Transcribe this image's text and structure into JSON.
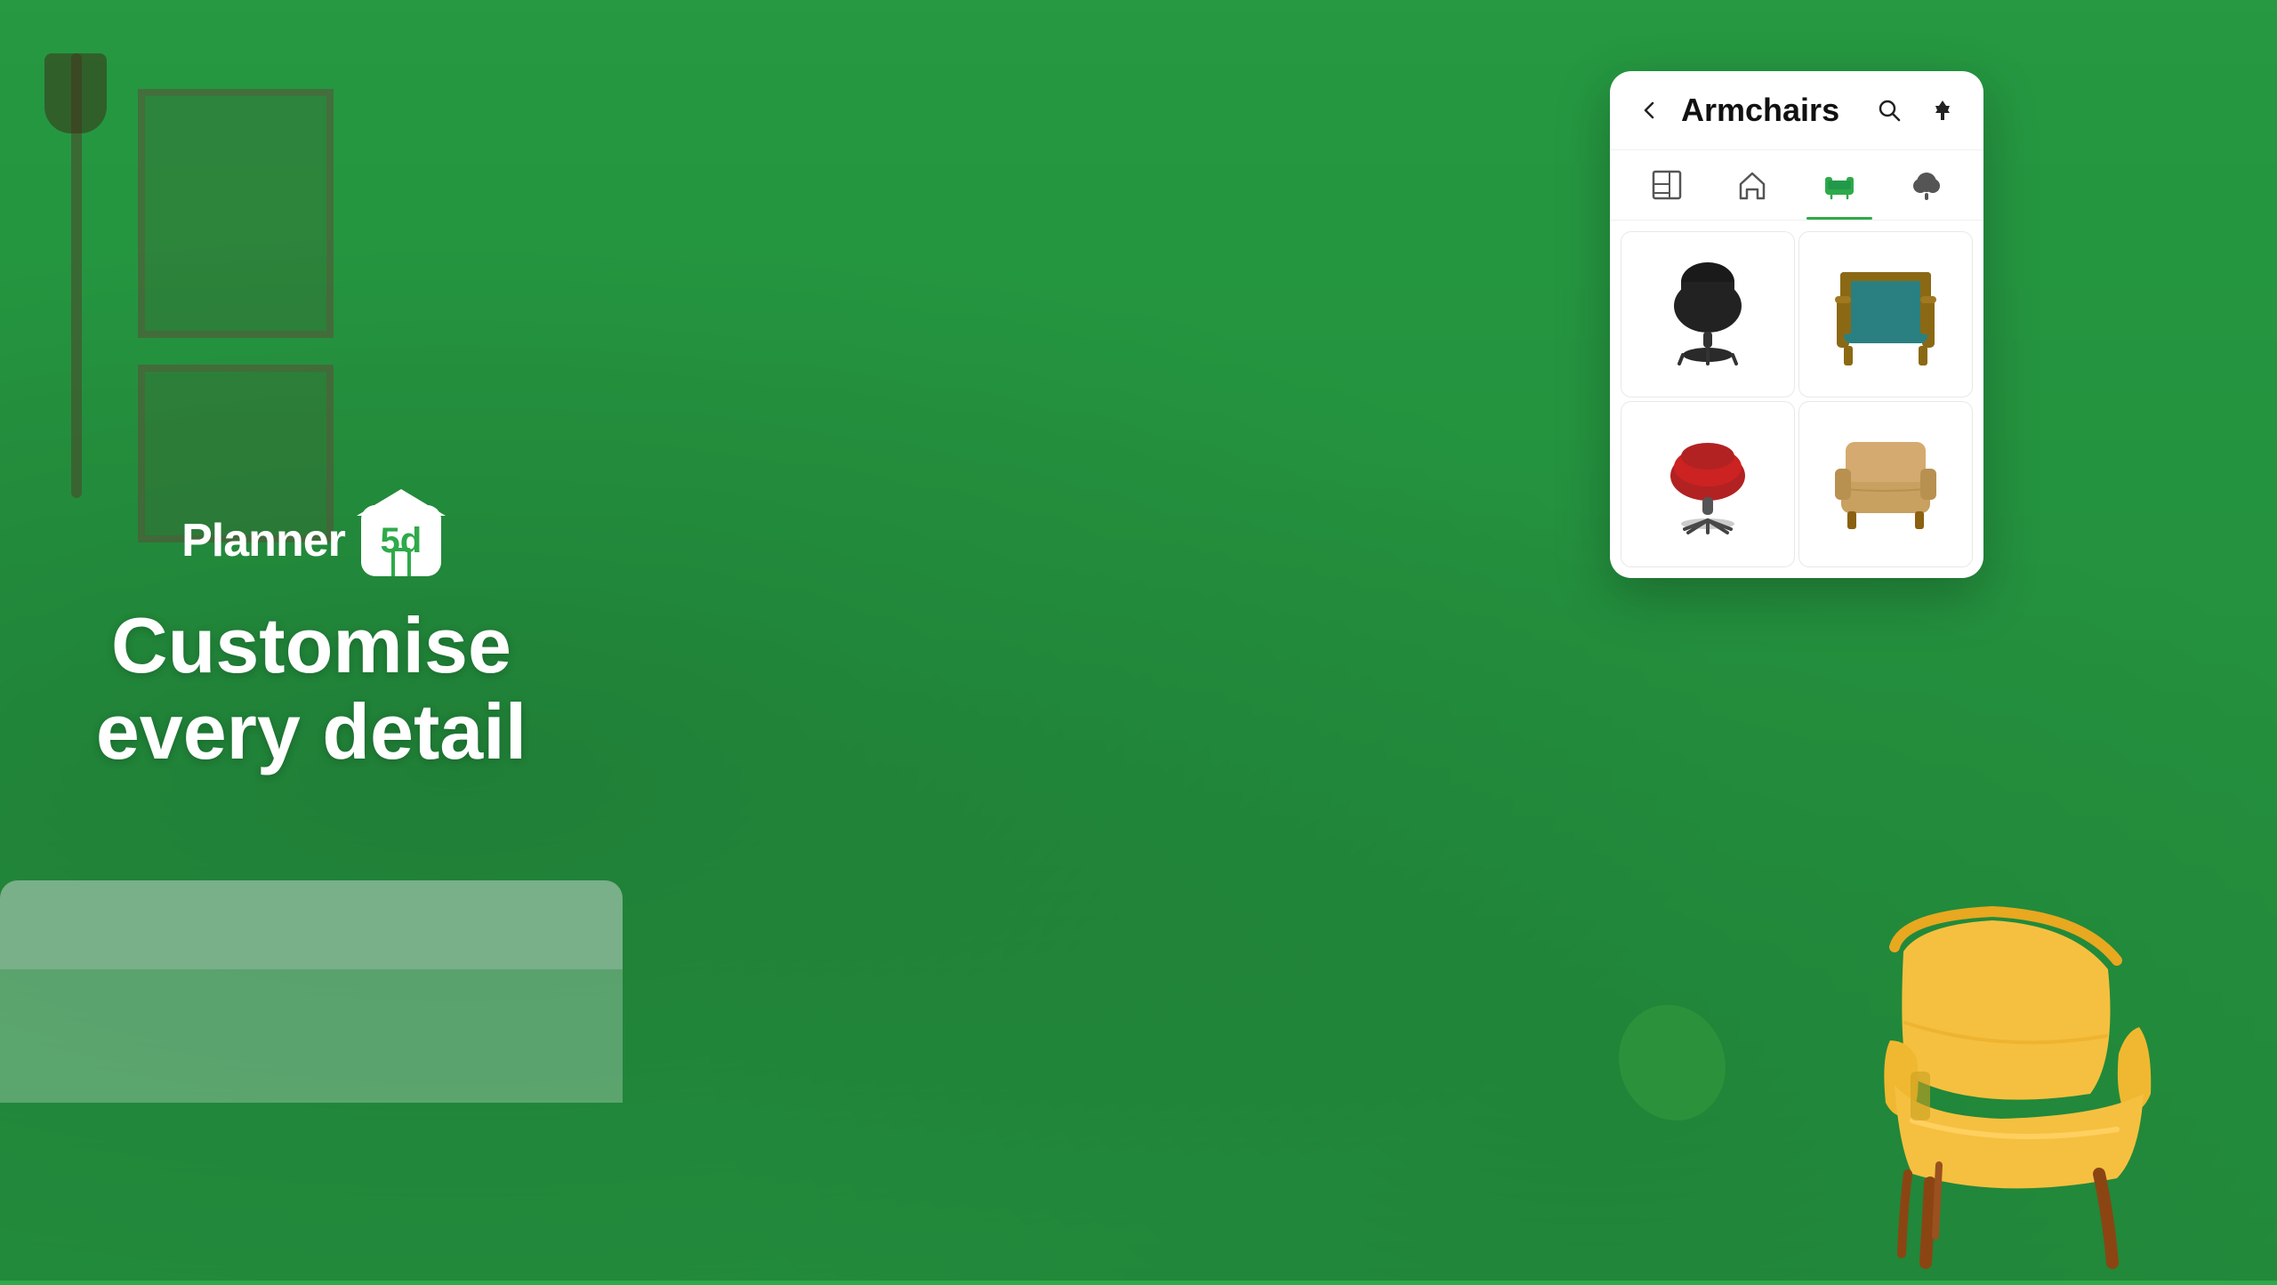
{
  "background": {
    "color": "#28a045"
  },
  "logo": {
    "text": "Planner",
    "badge": "5d"
  },
  "tagline": {
    "line1": "Customise",
    "line2": "every detail"
  },
  "modal": {
    "title": "Armchairs",
    "back_button_label": "←",
    "search_icon": "search-icon",
    "pin_icon": "pin-icon",
    "tabs": [
      {
        "id": "floorplan",
        "label": "Floor plan",
        "icon": "📐",
        "active": false
      },
      {
        "id": "home",
        "label": "Home",
        "icon": "🏠",
        "active": false
      },
      {
        "id": "furniture",
        "label": "Furniture",
        "icon": "🛋️",
        "active": true
      },
      {
        "id": "outdoor",
        "label": "Outdoor",
        "icon": "🌳",
        "active": false
      }
    ],
    "items": [
      {
        "id": 1,
        "name": "Black swivel chair",
        "type": "chair-black-swivel"
      },
      {
        "id": 2,
        "name": "Teal wood armchair",
        "type": "chair-teal-wood"
      },
      {
        "id": 3,
        "name": "Red swivel chair",
        "type": "chair-red-swivel"
      },
      {
        "id": 4,
        "name": "Tan armchair",
        "type": "chair-tan"
      }
    ]
  },
  "accent_color": "#2eaa4a"
}
